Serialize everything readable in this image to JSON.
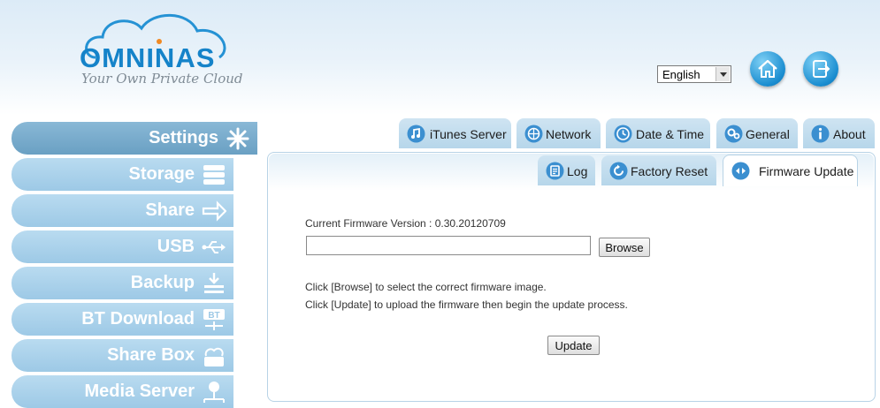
{
  "header": {
    "brand": "OMNINAS",
    "tagline": "Your Own Private Cloud",
    "language": {
      "selected": "English"
    },
    "home_icon": "home-icon",
    "logout_icon": "logout-icon"
  },
  "sidebar": {
    "items": [
      {
        "label": "Settings",
        "icon": "settings-icon",
        "active": true
      },
      {
        "label": "Storage",
        "icon": "storage-icon"
      },
      {
        "label": "Share",
        "icon": "share-icon"
      },
      {
        "label": "USB",
        "icon": "usb-icon"
      },
      {
        "label": "Backup",
        "icon": "backup-icon"
      },
      {
        "label": "BT Download",
        "icon": "bt-download-icon",
        "icon_text": "BT"
      },
      {
        "label": "Share Box",
        "icon": "share-box-icon"
      },
      {
        "label": "Media Server",
        "icon": "media-server-icon"
      }
    ]
  },
  "tabs_top": [
    {
      "label": "iTunes Server",
      "icon": "itunes-icon"
    },
    {
      "label": "Network",
      "icon": "network-icon"
    },
    {
      "label": "Date & Time",
      "icon": "clock-icon"
    },
    {
      "label": "General",
      "icon": "gears-icon"
    },
    {
      "label": "About",
      "icon": "info-icon"
    }
  ],
  "tabs_sub": [
    {
      "label": "Log",
      "icon": "log-icon"
    },
    {
      "label": "Factory Reset",
      "icon": "reset-icon"
    },
    {
      "label": "Firmware Update",
      "icon": "firmware-icon",
      "active": true
    }
  ],
  "firmware": {
    "version_label": "Current Firmware Version : 0.30.20120709",
    "file_value": "",
    "browse_label": "Browse",
    "hint_browse": "Click [Browse] to select the correct firmware image.",
    "hint_update": "Click [Update] to upload the firmware then begin the update process.",
    "update_label": "Update"
  },
  "colors": {
    "accent": "#1583c9",
    "sidebar_active": "#6aa0c3",
    "sidebar_item": "#a8d0ea",
    "tab_bg": "#c3ddee",
    "panel_border": "#b8d3e6"
  }
}
